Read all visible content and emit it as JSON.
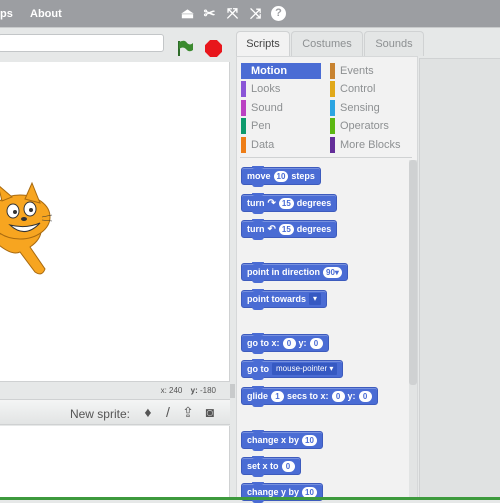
{
  "menubar": {
    "items": [
      "ps",
      "About"
    ],
    "icons": [
      "duplicate-stamp-icon",
      "cut-scissors-icon",
      "grow-icon",
      "shrink-icon",
      "help-icon"
    ]
  },
  "stage": {
    "project_title": "",
    "coords": {
      "x_label": "x:",
      "x_value": "240",
      "y_label": "y:",
      "y_value": "-180"
    }
  },
  "sprites": {
    "new_sprite_label": "New sprite:",
    "icons": [
      "choose-from-library-icon",
      "paint-new-sprite-icon",
      "upload-sprite-icon",
      "camera-icon"
    ]
  },
  "tabs": [
    {
      "label": "Scripts",
      "active": true
    },
    {
      "label": "Costumes",
      "active": false
    },
    {
      "label": "Sounds",
      "active": false
    }
  ],
  "categories": [
    {
      "label": "Motion",
      "color": "#4a6cd4",
      "selected": true
    },
    {
      "label": "Looks",
      "color": "#8a55d7"
    },
    {
      "label": "Sound",
      "color": "#bb42c3"
    },
    {
      "label": "Pen",
      "color": "#0e9a6c"
    },
    {
      "label": "Data",
      "color": "#ee7d16"
    },
    {
      "label": "Events",
      "color": "#c88330"
    },
    {
      "label": "Control",
      "color": "#e1a91a"
    },
    {
      "label": "Sensing",
      "color": "#2ca5e2"
    },
    {
      "label": "Operators",
      "color": "#5cb712"
    },
    {
      "label": "More Blocks",
      "color": "#632d99"
    }
  ],
  "blocks": {
    "move": {
      "a": "move",
      "v": "10",
      "b": "steps"
    },
    "turn_right": {
      "a": "turn",
      "icon": "↷",
      "v": "15",
      "b": "degrees"
    },
    "turn_left": {
      "a": "turn",
      "icon": "↶",
      "v": "15",
      "b": "degrees"
    },
    "point_dir": {
      "a": "point in direction",
      "v": "90▾"
    },
    "point_towards": {
      "a": "point towards",
      "v": "▾"
    },
    "goto_xy": {
      "a": "go to x:",
      "x": "0",
      "b": "y:",
      "y": "0"
    },
    "goto": {
      "a": "go to",
      "v": "mouse-pointer ▾"
    },
    "glide": {
      "a": "glide",
      "v": "1",
      "b": "secs to x:",
      "x": "0",
      "c": "y:",
      "y": "0"
    },
    "change_x": {
      "a": "change x by",
      "v": "10"
    },
    "set_x": {
      "a": "set x to",
      "v": "0"
    },
    "change_y": {
      "a": "change y by",
      "v": "10"
    }
  }
}
